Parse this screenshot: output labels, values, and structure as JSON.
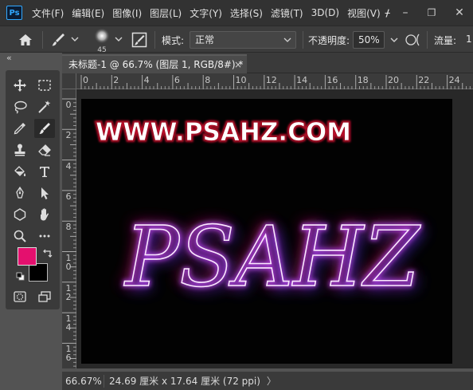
{
  "app": {
    "logo": "Ps"
  },
  "menu": [
    "文件(F)",
    "编辑(E)",
    "图像(I)",
    "图层(L)",
    "文字(Y)",
    "选择(S)",
    "滤镜(T)",
    "3D(D)",
    "视图(V)"
  ],
  "menu_more": "ᚋ",
  "window_controls": {
    "minimize": "–",
    "restore": "❐",
    "close": "✕"
  },
  "options": {
    "brush_size": "45",
    "mode_label": "模式:",
    "mode_value": "正常",
    "opacity_label": "不透明度:",
    "opacity_value": "50%",
    "flow_label": "流量:",
    "flow_value": "1"
  },
  "collapse": "«",
  "tab": {
    "title": "未标题-1 @ 66.7% (图层 1, RGB/8#) *",
    "close": "×"
  },
  "ruler": {
    "h": [
      "0",
      "2",
      "4",
      "6",
      "8",
      "10",
      "12",
      "14",
      "16",
      "18",
      "20",
      "22",
      "24"
    ],
    "v": [
      "0",
      "2",
      "4",
      "6",
      "8",
      "1\n0",
      "1\n2",
      "1\n4",
      "1\n6"
    ]
  },
  "canvas": {
    "watermark": "WWW.PSAHZ.COM",
    "art_text": "PSAHZ"
  },
  "colors": {
    "foreground": "#e4106e",
    "background": "#000000"
  },
  "status": {
    "zoom": "66.67%",
    "doc_size": "24.69 厘米 x 17.64 厘米 (72 ppi)",
    "arrow": "〉"
  }
}
